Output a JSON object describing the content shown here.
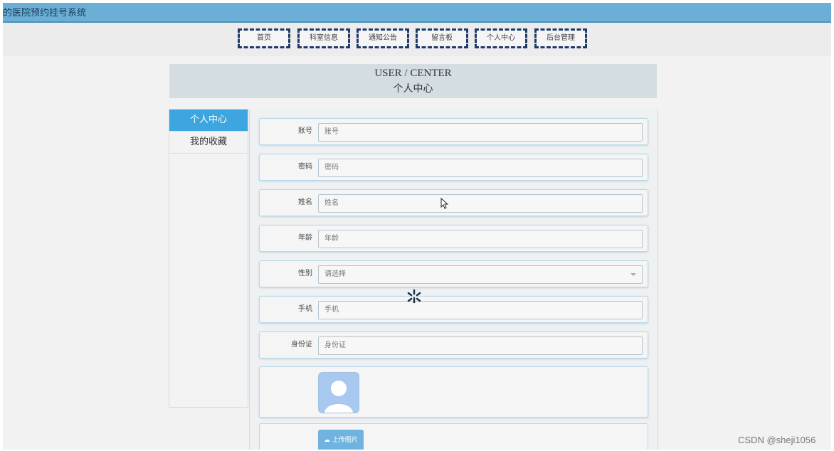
{
  "app": {
    "title": "的医院预约挂号系统"
  },
  "nav": {
    "items": [
      {
        "label": "首页"
      },
      {
        "label": "科室信息"
      },
      {
        "label": "通知公告"
      },
      {
        "label": "留言板"
      },
      {
        "label": "个人中心"
      },
      {
        "label": "后台管理"
      }
    ]
  },
  "header": {
    "en": "USER / CENTER",
    "cn": "个人中心"
  },
  "sidebar": {
    "items": [
      {
        "label": "个人中心",
        "active": true
      },
      {
        "label": "我的收藏",
        "active": false
      }
    ]
  },
  "form": {
    "fields": [
      {
        "label": "账号",
        "placeholder": "账号"
      },
      {
        "label": "密码",
        "placeholder": "密码"
      },
      {
        "label": "姓名",
        "placeholder": "姓名"
      },
      {
        "label": "年龄",
        "placeholder": "年龄"
      },
      {
        "label": "性别",
        "placeholder": "请选择"
      },
      {
        "label": "手机",
        "placeholder": "手机"
      },
      {
        "label": "身份证",
        "placeholder": "身份证"
      }
    ],
    "upload_label": "上传图片"
  },
  "colors": {
    "topbar": "#6bafd6",
    "active": "#3da5e0",
    "nav_border": "#1f3a68"
  },
  "watermark": "CSDN @sheji1056"
}
